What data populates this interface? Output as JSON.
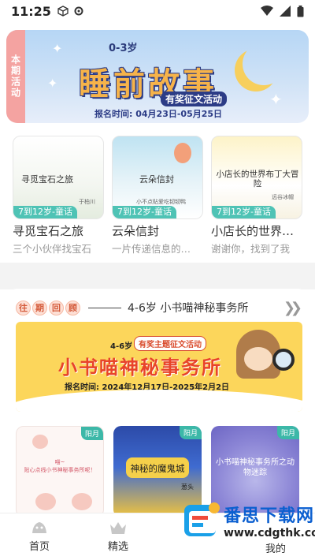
{
  "status_bar": {
    "time": "11:25"
  },
  "banner": {
    "side_label": "本期活动",
    "age": "0-3岁",
    "title": "睡前故事",
    "subtitle": "有奖征文活动",
    "date": "报名时间: 04月23日-05月25日"
  },
  "stories": [
    {
      "thumb_title": "寻觅宝石之旅",
      "thumb_author": "于柏川",
      "tag": "7到12岁-童话",
      "name": "寻觅宝石之旅",
      "desc": "三个小伙伴找宝石"
    },
    {
      "thumb_title": "云朵信封",
      "thumb_author": "小不点贴爱吃韧韧鸭",
      "tag": "7到12岁-童话",
      "name": "云朵信封",
      "desc": "一片传递信息的…"
    },
    {
      "thumb_title": "小店长的世界布丁大冒险",
      "thumb_author": "远谷冰帽",
      "tag": "7到12岁-童话",
      "name": "小店长的世界…",
      "desc": "谢谢你，找到了我"
    }
  ],
  "past": {
    "badge": [
      "往",
      "期",
      "回",
      "顾"
    ],
    "title": "4-6岁 小书喵神秘事务所",
    "more_icon": "double-chevron-right-icon",
    "event": {
      "age": "4-6岁",
      "tag": "有奖主题征文活动",
      "title": "小书喵神秘事务所",
      "date": "报名时间: 2024年12月17日-2025年2月2日"
    },
    "thumbs": [
      {
        "corner": "阳月",
        "text": "喵~\n贴心点线小书神秘事务所呢！"
      },
      {
        "corner": "阳月",
        "text": "神秘的魔鬼城",
        "author": "葱头"
      },
      {
        "corner": "阳月",
        "text": "小书喵神秘事务所之动物迷踪"
      }
    ]
  },
  "nav": {
    "items": [
      {
        "label": "首页",
        "icon": "home-icon"
      },
      {
        "label": "精选",
        "icon": "crown-icon"
      },
      {
        "label": "",
        "icon": ""
      },
      {
        "label": "我的",
        "icon": "user-icon"
      }
    ]
  },
  "watermark": {
    "title": "番思下载网",
    "url": "www.cdgthk.com"
  },
  "colors": {
    "teal_tag": "#4fc3b5",
    "banner_pink": "#f4a3a1",
    "event_yellow": "#fcd65b"
  }
}
